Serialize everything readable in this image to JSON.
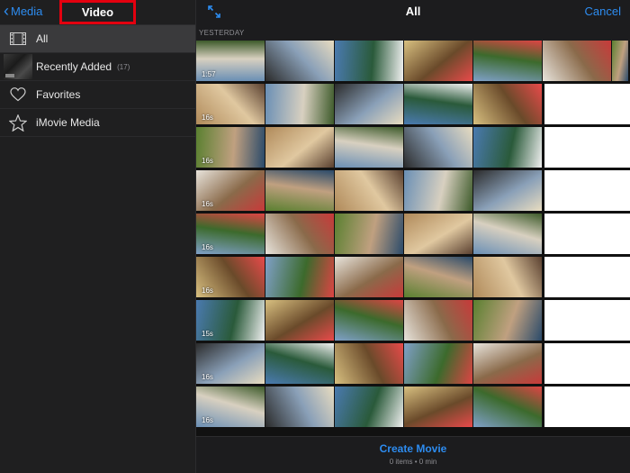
{
  "sidebar": {
    "back_label": "Media",
    "title": "Video",
    "items": [
      {
        "label": "All",
        "count": "",
        "icon": "film-icon",
        "selected": true
      },
      {
        "label": "Recently Added",
        "count": "(17)",
        "icon": "thumbnail",
        "selected": false
      },
      {
        "label": "Favorites",
        "count": "",
        "icon": "heart-icon",
        "selected": false
      },
      {
        "label": "iMovie Media",
        "count": "",
        "icon": "star-icon",
        "selected": false
      }
    ]
  },
  "header": {
    "title": "All",
    "cancel_label": "Cancel",
    "expand_icon": "expand-icon"
  },
  "section_label": "YESTERDAY",
  "grid": {
    "rows": [
      [
        {
          "d": "1:57"
        },
        {
          "d": ""
        },
        {
          "d": ""
        },
        {
          "d": ""
        },
        {
          "d": ""
        },
        {
          "d": ""
        },
        {
          "d": ""
        }
      ],
      [
        {
          "d": "16s"
        },
        {
          "d": ""
        },
        {
          "d": ""
        },
        {
          "d": ""
        },
        {
          "d": ""
        }
      ],
      [
        {
          "d": "16s"
        },
        {
          "d": ""
        },
        {
          "d": ""
        },
        {
          "d": ""
        },
        {
          "d": ""
        }
      ],
      [
        {
          "d": "16s"
        },
        {
          "d": ""
        },
        {
          "d": ""
        },
        {
          "d": ""
        },
        {
          "d": ""
        }
      ],
      [
        {
          "d": "16s"
        },
        {
          "d": ""
        },
        {
          "d": ""
        },
        {
          "d": ""
        },
        {
          "d": ""
        }
      ],
      [
        {
          "d": "16s"
        },
        {
          "d": ""
        },
        {
          "d": ""
        },
        {
          "d": ""
        },
        {
          "d": ""
        }
      ],
      [
        {
          "d": "15s"
        },
        {
          "d": ""
        },
        {
          "d": ""
        },
        {
          "d": ""
        },
        {
          "d": ""
        }
      ],
      [
        {
          "d": "16s"
        },
        {
          "d": ""
        },
        {
          "d": ""
        },
        {
          "d": ""
        },
        {
          "d": ""
        }
      ],
      [
        {
          "d": "16s"
        },
        {
          "d": ""
        },
        {
          "d": ""
        },
        {
          "d": ""
        },
        {
          "d": ""
        }
      ]
    ]
  },
  "footer": {
    "create_label": "Create Movie",
    "status": "0 items • 0 min"
  },
  "colors": {
    "accent": "#2d8cf0",
    "highlight_box": "#e3000f",
    "background": "#1c1c1e"
  }
}
